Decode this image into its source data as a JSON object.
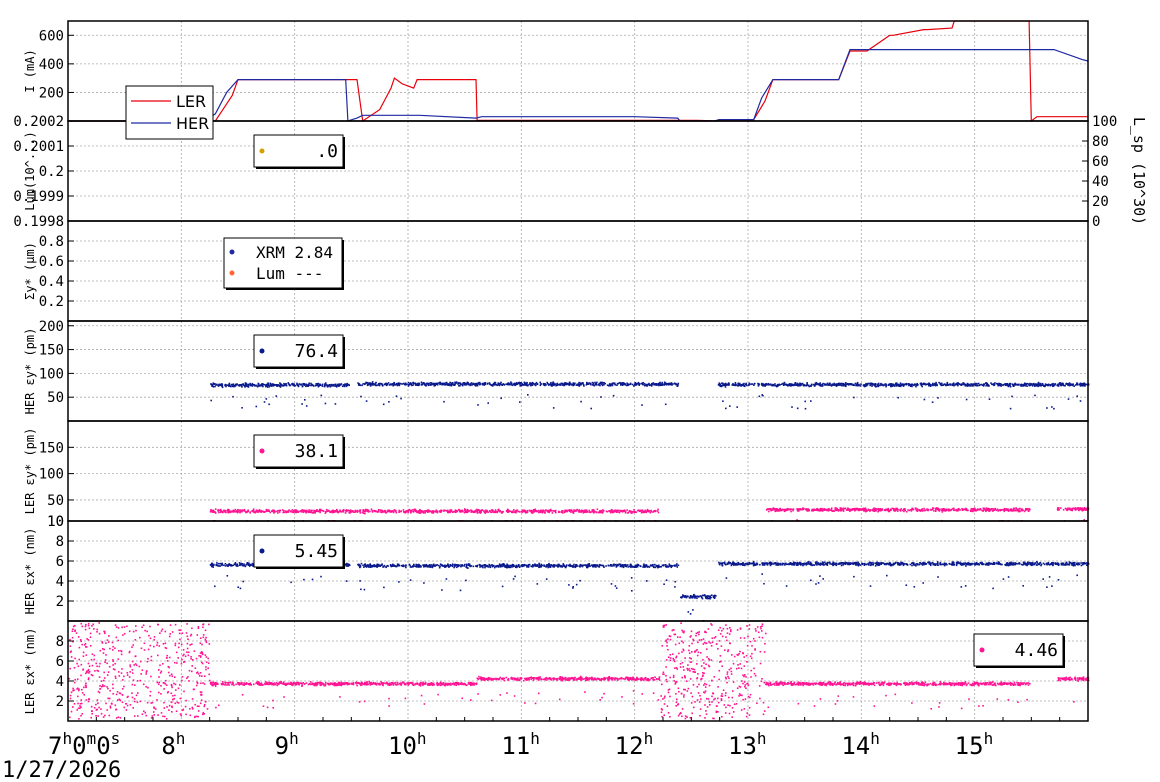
{
  "colors": {
    "background": "#ffffff",
    "frame": "#000000",
    "grid": "#aaaaaa",
    "ler": "#e8000b",
    "her": "#1f2aa0",
    "her_points": "#0a1a8c",
    "ler_points": "#ff1493",
    "lum_point": "#d4a000",
    "lum_dash_point": "#ff6633",
    "legend_border": "#000000"
  },
  "footer": {
    "date": "1/27/2026",
    "time_origin": "7h0m0s"
  },
  "chart_data": {
    "type": "multi-panel time series",
    "x_axis": {
      "range_hours": [
        7,
        16
      ],
      "major_ticks": [
        7,
        8,
        9,
        10,
        11,
        12,
        13,
        14,
        15
      ],
      "tick_labels": [
        "7h0m0s",
        "8h",
        "9h",
        "10h",
        "11h",
        "12h",
        "13h",
        "14h",
        "15h"
      ],
      "grid": true
    },
    "panels": [
      {
        "id": "current",
        "ylabel": "I (mA)",
        "ylim": [
          0,
          700
        ],
        "yticks": [
          200,
          400,
          600
        ],
        "ytick_labels": [
          "200",
          "400",
          "600"
        ],
        "legend": {
          "position": "left",
          "entries": [
            "LER",
            "HER"
          ]
        },
        "series": [
          {
            "name": "LER",
            "color_key": "ler",
            "x": [
              7.0,
              8.3,
              8.35,
              8.45,
              8.5,
              9.55,
              9.6,
              9.75,
              9.85,
              9.88,
              9.95,
              10.05,
              10.08,
              10.6,
              10.61,
              12.55,
              12.73,
              12.74,
              13.05,
              13.15,
              13.22,
              13.8,
              13.9,
              14.05,
              14.25,
              14.28,
              14.55,
              14.58,
              14.8,
              14.82,
              15.48,
              15.5,
              15.55,
              15.8,
              16.0
            ],
            "y": [
              0,
              0,
              60,
              180,
              290,
              290,
              0,
              80,
              230,
              300,
              260,
              230,
              290,
              290,
              5,
              5,
              0,
              10,
              10,
              140,
              290,
              290,
              490,
              490,
              600,
              600,
              640,
              640,
              650,
              700,
              700,
              0,
              30,
              30,
              30
            ]
          },
          {
            "name": "HER",
            "color_key": "her",
            "x": [
              7.0,
              8.2,
              8.3,
              8.4,
              8.5,
              9.45,
              9.47,
              9.55,
              9.6,
              10.1,
              10.6,
              10.65,
              12.0,
              12.38,
              12.4,
              12.7,
              12.75,
              13.05,
              13.12,
              13.22,
              13.8,
              13.9,
              15.7,
              15.95,
              16.0
            ],
            "y": [
              0,
              0,
              50,
              200,
              290,
              290,
              0,
              20,
              40,
              40,
              20,
              30,
              30,
              20,
              0,
              0,
              10,
              10,
              160,
              290,
              290,
              500,
              500,
              430,
              420
            ]
          }
        ]
      },
      {
        "id": "luminosity",
        "ylabel": "Lum(10^...)",
        "ylim": [
          0.1998,
          0.2002
        ],
        "yticks": [
          0.1998,
          0.1999,
          0.2,
          0.2001,
          0.2002
        ],
        "ytick_labels": [
          "0.1998",
          "0.1999",
          "0.2",
          "0.2001",
          "0.2002"
        ],
        "right_axis": {
          "label": "L_sp (10^30)",
          "ylim": [
            0,
            100
          ],
          "yticks": [
            0,
            20,
            40,
            60,
            80,
            100
          ],
          "ytick_labels": [
            "0",
            "20",
            "40",
            "60",
            "80",
            "100"
          ]
        },
        "legend": {
          "position": "top-left",
          "value": ".0",
          "color_key": "lum_point"
        }
      },
      {
        "id": "sigma_y",
        "ylabel": "Σy* (μm)",
        "ylim": [
          0,
          1.0
        ],
        "yticks": [
          0.2,
          0.4,
          0.6,
          0.8
        ],
        "ytick_labels": [
          "0.2",
          "0.4",
          "0.6",
          "0.8"
        ],
        "legend": {
          "position": "top-left",
          "entries": [
            {
              "name": "XRM",
              "value": "2.84",
              "color_key": "her"
            },
            {
              "name": "Lum",
              "value": "---",
              "color_key": "lum_dash_point"
            }
          ]
        }
      },
      {
        "id": "her_eps_y",
        "ylabel": "HER εy* (pm)",
        "ylim": [
          0,
          210
        ],
        "yticks": [
          50,
          100,
          150,
          200
        ],
        "ytick_labels": [
          "50",
          "100",
          "150",
          "200"
        ],
        "legend": {
          "position": "top-left",
          "value": "76.4",
          "color_key": "her_points"
        },
        "segments": [
          [
            8.25,
            9.48,
            77
          ],
          [
            9.55,
            12.38,
            79
          ],
          [
            12.73,
            16.0,
            78
          ]
        ]
      },
      {
        "id": "ler_eps_y",
        "ylabel": "LER εy* (pm)",
        "ylim": [
          10,
          200
        ],
        "yticks": [
          10,
          50,
          100,
          150
        ],
        "ytick_labels": [
          "10",
          "50",
          "100",
          "150"
        ],
        "legend": {
          "position": "top-left",
          "value": "38.1",
          "color_key": "ler_points"
        },
        "segments": [
          [
            8.25,
            12.22,
            30
          ],
          [
            13.15,
            15.48,
            33
          ],
          [
            15.72,
            16.0,
            34
          ]
        ]
      },
      {
        "id": "her_eps_x",
        "ylabel": "HER εx* (nm)",
        "ylim": [
          0,
          10
        ],
        "yticks": [
          2,
          4,
          6,
          8,
          10
        ],
        "ytick_labels": [
          "2",
          "4",
          "6",
          "8",
          "10"
        ],
        "legend": {
          "position": "top-left",
          "value": "5.45",
          "color_key": "her_points"
        },
        "segments": [
          [
            8.25,
            9.48,
            5.7
          ],
          [
            9.55,
            12.38,
            5.6
          ],
          [
            12.4,
            12.72,
            2.5
          ],
          [
            12.73,
            16.0,
            5.8
          ]
        ]
      },
      {
        "id": "ler_eps_x",
        "ylabel": "LER εx* (nm)",
        "ylim": [
          0,
          10
        ],
        "yticks": [
          2,
          4,
          6,
          8
        ],
        "ytick_labels": [
          "2",
          "4",
          "6",
          "8"
        ],
        "legend": {
          "position": "top-right",
          "value": "4.46",
          "color_key": "ler_points"
        },
        "segments": [
          [
            8.25,
            10.6,
            3.8
          ],
          [
            10.6,
            12.22,
            4.3
          ],
          [
            13.15,
            15.48,
            3.8
          ],
          [
            15.72,
            16.0,
            4.3
          ]
        ]
      }
    ]
  }
}
